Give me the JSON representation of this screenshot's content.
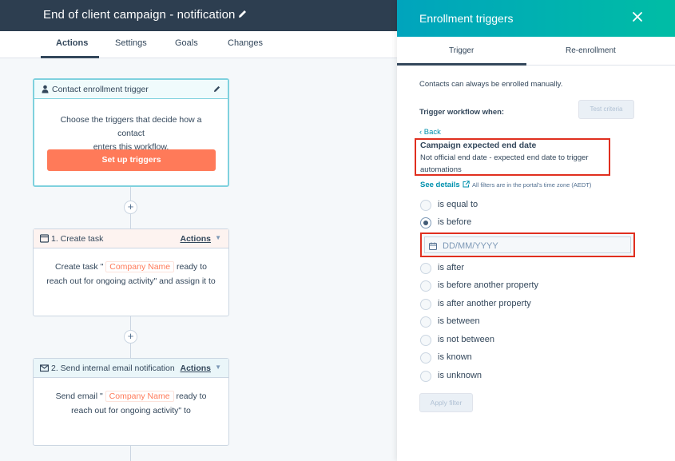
{
  "header": {
    "title": "End of client campaign - notification",
    "tabs": [
      "Actions",
      "Settings",
      "Goals",
      "Changes"
    ]
  },
  "canvas": {
    "trigger_card": {
      "title": "Contact enrollment trigger",
      "desc_line1": "Choose the triggers that decide how a contact",
      "desc_line2": "enters this workflow.",
      "button": "Set up triggers"
    },
    "task_card": {
      "title": "1. Create task",
      "actions": "Actions",
      "line1_pre": "Create task \"",
      "token": "Company Name",
      "line1_post": "ready to",
      "line2": "reach out for ongoing activity\" and assign it to"
    },
    "email_card": {
      "title": "2. Send internal email notification",
      "actions": "Actions",
      "line1_pre": "Send email \"",
      "token": "Company Name",
      "line1_post": "ready to",
      "line2": "reach out for ongoing activity\" to"
    },
    "plus": "+"
  },
  "panel": {
    "title": "Enrollment triggers",
    "tabs": [
      "Trigger",
      "Re-enrollment"
    ],
    "note": "Contacts can always be enrolled manually.",
    "trigger_when": "Trigger workflow when:",
    "test_criteria": "Test criteria",
    "back": "‹ Back",
    "property": {
      "name": "Campaign expected end date",
      "description": "Not official end date - expected end date to trigger automations"
    },
    "see_details": "See details",
    "timezone_note": "All filters are in the portal's time zone (AEDT)",
    "options": [
      {
        "label": "is equal to",
        "selected": false
      },
      {
        "label": "is before",
        "selected": true
      },
      {
        "label": "is after",
        "selected": false
      },
      {
        "label": "is before another property",
        "selected": false
      },
      {
        "label": "is after another property",
        "selected": false
      },
      {
        "label": "is between",
        "selected": false
      },
      {
        "label": "is not between",
        "selected": false
      },
      {
        "label": "is known",
        "selected": false
      },
      {
        "label": "is unknown",
        "selected": false
      }
    ],
    "date_placeholder": "DD/MM/YYYY",
    "apply_filter": "Apply filter"
  },
  "colors": {
    "header_bg": "#2d3e50",
    "panel_gradient_start": "#00a4bd",
    "panel_gradient_end": "#00bda5",
    "primary_button": "#ff7a59",
    "highlight_box": "#e02f1f",
    "link": "#0091ae"
  }
}
